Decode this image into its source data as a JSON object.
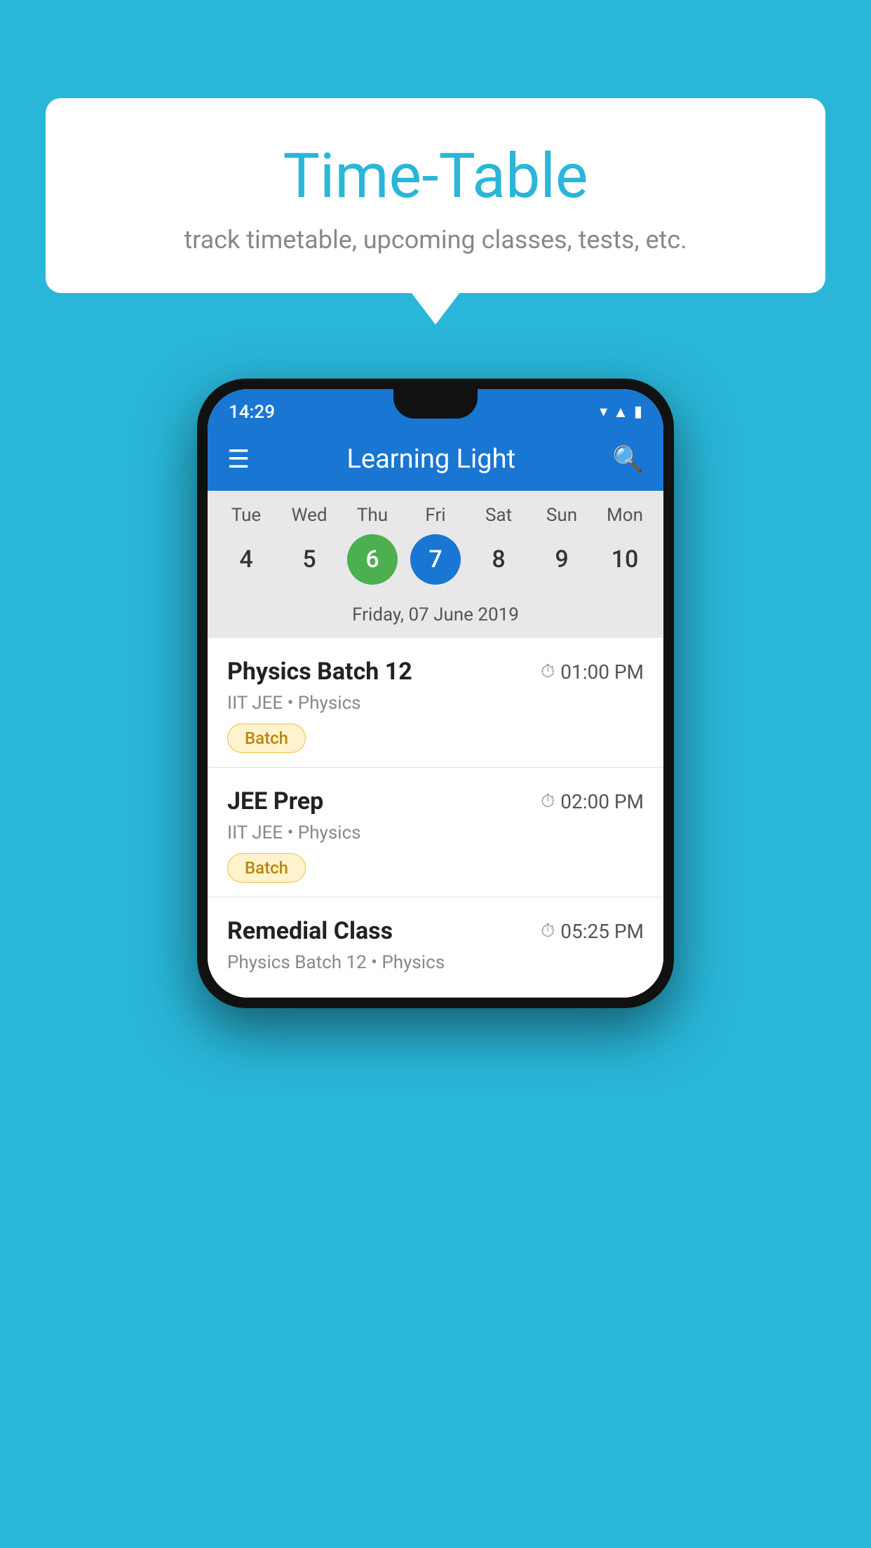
{
  "background_color": "#29b6d8",
  "speech_bubble": {
    "title": "Time-Table",
    "subtitle": "track timetable, upcoming classes, tests, etc."
  },
  "phone": {
    "status_bar": {
      "time": "14:29"
    },
    "app_bar": {
      "title": "Learning Light"
    },
    "calendar": {
      "days": [
        {
          "label": "Tue",
          "num": "4",
          "state": "normal"
        },
        {
          "label": "Wed",
          "num": "5",
          "state": "normal"
        },
        {
          "label": "Thu",
          "num": "6",
          "state": "today"
        },
        {
          "label": "Fri",
          "num": "7",
          "state": "selected"
        },
        {
          "label": "Sat",
          "num": "8",
          "state": "normal"
        },
        {
          "label": "Sun",
          "num": "9",
          "state": "normal"
        },
        {
          "label": "Mon",
          "num": "10",
          "state": "normal"
        }
      ],
      "selected_date_label": "Friday, 07 June 2019"
    },
    "classes": [
      {
        "name": "Physics Batch 12",
        "time": "01:00 PM",
        "subject": "IIT JEE • Physics",
        "tag": "Batch"
      },
      {
        "name": "JEE Prep",
        "time": "02:00 PM",
        "subject": "IIT JEE • Physics",
        "tag": "Batch"
      },
      {
        "name": "Remedial Class",
        "time": "05:25 PM",
        "subject": "Physics Batch 12 • Physics",
        "tag": null
      }
    ]
  }
}
